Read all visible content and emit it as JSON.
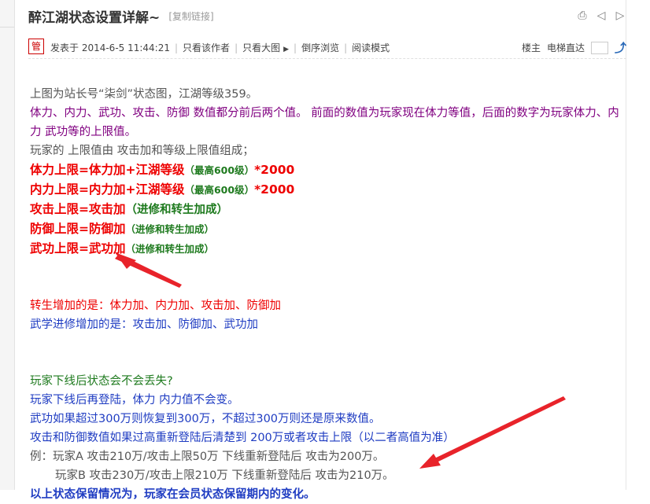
{
  "header": {
    "title": "醉江湖状态设置详解~",
    "copy_link": "[复制链接]",
    "icons": [
      "print-icon",
      "prev-icon",
      "next-icon"
    ]
  },
  "meta": {
    "badge": "管",
    "posted": "发表于 2014-6-5 11:44:21",
    "only_author": "只看该作者",
    "big_image": "只看大图",
    "reverse": "倒序浏览",
    "read_mode": "阅读模式",
    "floor_owner": "楼主",
    "elevator": "电梯直达"
  },
  "content": {
    "intro": "上图为站长号“柒剑”状态图，江湖等级359。",
    "desc1": "体力、内力、武功、攻击、防御 数值都分前后两个值。 前面的数值为玩家现在体力等值，后面的数字为玩家体力、内力 武功等的上限值。",
    "desc2": "玩家的 上限值由 攻击加和等级上限值组成；",
    "hp_main": "体力上限=体力加+江湖等级",
    "hp_note": "（最高600级）",
    "hp_mult": "*2000",
    "mp_main": "内力上限=内力加+江湖等级",
    "mp_note": "（最高600级）",
    "mp_mult": "*2000",
    "atk_main": "攻击上限=攻击加",
    "atk_note": "（进修和转生加成）",
    "def_main": "防御上限=防御加",
    "def_note": "（进修和转生加成）",
    "wg_main": "武功上限=武功加",
    "wg_note": "（进修和转生加成）",
    "rebirth": "转生增加的是：体力加、内力加、攻击加、防御加",
    "study": "武学进修增加的是：攻击加、防御加、武功加",
    "q": "玩家下线后状态会不会丢失?",
    "a1": "玩家下线后再登陆，体力 内力值不会变。",
    "a2": "武功如果超过300万则恢复到300万，不超过300万则还是原来数值。",
    "a3": "攻击和防御数值如果过高重新登陆后清楚到 200万或者攻击上限（以二者高值为准）",
    "ex1": "例：玩家A  攻击210万/攻击上限50万  下线重新登陆后 攻击为200万。",
    "ex2": "玩家B  攻击230万/攻击上限210万  下线重新登陆后 攻击为210万。",
    "footer": "以上状态保留情况为，玩家在会员状态保留期内的变化。"
  },
  "colors": {
    "red": "#e00000",
    "purple": "#800080",
    "blue": "#1f3cc2",
    "green": "#1e7a1e",
    "arrow": "#e8232a"
  }
}
